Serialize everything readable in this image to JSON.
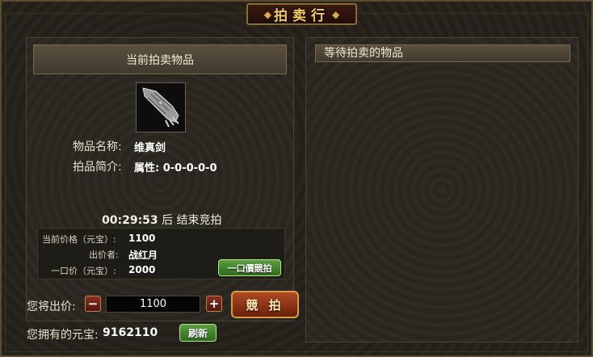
{
  "window": {
    "title": "拍卖行"
  },
  "current": {
    "header": "当前拍卖物品",
    "item_name_label": "物品名称:",
    "item_name": "维真剑",
    "intro_label": "拍品简介:",
    "intro_value": "属性: 0-0-0-0-0",
    "timer": "00:29:53",
    "timer_suffix": "后 结束竞拍",
    "price_label": "当前价格（元宝）:",
    "price": "1100",
    "bidder_label": "出价者:",
    "bidder": "战红月",
    "buyout_label": "一口价（元宝）:",
    "buyout": "2000",
    "buyout_button": "一口價競拍"
  },
  "bid": {
    "label": "您将出价:",
    "minus": "−",
    "plus": "+",
    "value": "1100",
    "button": "競 拍"
  },
  "balance": {
    "label": "您拥有的元宝:",
    "value": "9162110",
    "refresh_button": "刷新"
  },
  "waiting": {
    "header": "等待拍卖的物品"
  },
  "colors": {
    "gold": "#f2cc6a",
    "frame": "#5a4a30",
    "green_button": "#4a8e34",
    "red_button": "#8a3020"
  }
}
